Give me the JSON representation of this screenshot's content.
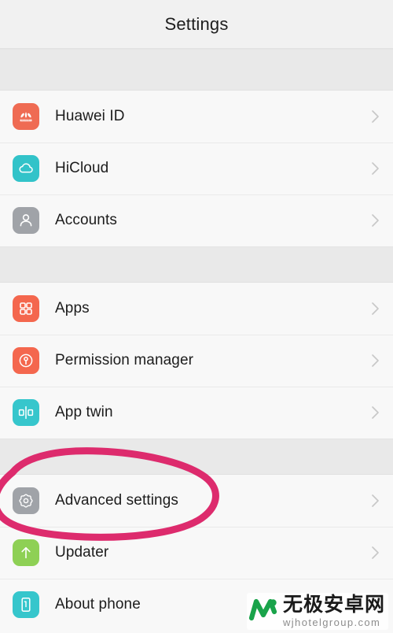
{
  "header": {
    "title": "Settings"
  },
  "colors": {
    "huawei_red": "#ef6b53",
    "cloud_teal": "#32c3c9",
    "account_gray": "#a0a3a8",
    "apps_red": "#f4674e",
    "permission_red": "#f4674e",
    "apptwin_teal": "#36c6cc",
    "advanced_gray": "#a0a3a8",
    "updater_green": "#8ed055",
    "about_teal": "#36c6cc",
    "chevron_gray": "#c8c8c8",
    "annotation_pink": "#dd2b6d",
    "page_bg": "#f8f8f8",
    "header_bg": "#f1f1f1",
    "gap_bg": "#e9e9e9"
  },
  "sections": [
    {
      "name": "accounts-section",
      "items": [
        {
          "id": "huawei-id",
          "label": "Huawei ID",
          "icon": "huawei-logo-icon",
          "chevron": "chevron-right-icon"
        },
        {
          "id": "hicloud",
          "label": "HiCloud",
          "icon": "cloud-icon",
          "chevron": "chevron-right-icon"
        },
        {
          "id": "accounts",
          "label": "Accounts",
          "icon": "person-icon",
          "chevron": "chevron-right-icon"
        }
      ]
    },
    {
      "name": "apps-section",
      "items": [
        {
          "id": "apps",
          "label": "Apps",
          "icon": "grid-apps-icon",
          "chevron": "chevron-right-icon"
        },
        {
          "id": "permission-manager",
          "label": "Permission manager",
          "icon": "lock-circle-icon",
          "chevron": "chevron-right-icon"
        },
        {
          "id": "app-twin",
          "label": "App twin",
          "icon": "app-twin-icon",
          "chevron": "chevron-right-icon"
        }
      ]
    },
    {
      "name": "system-section",
      "items": [
        {
          "id": "advanced-settings",
          "label": "Advanced settings",
          "icon": "gear-icon",
          "chevron": "chevron-right-icon"
        },
        {
          "id": "updater",
          "label": "Updater",
          "icon": "up-arrow-icon",
          "chevron": "chevron-right-icon"
        },
        {
          "id": "about-phone",
          "label": "About phone",
          "icon": "phone-icon",
          "chevron": "chevron-right-icon"
        }
      ]
    }
  ],
  "annotation": {
    "name": "highlight-ellipse",
    "target": "Advanced settings",
    "shape": "hand-drawn-ellipse",
    "color": "#dd2b6d"
  },
  "watermark": {
    "logo": "wj-logo-icon",
    "cn_text": "无极安卓网",
    "url_text": "wjhotelgroup.com"
  }
}
